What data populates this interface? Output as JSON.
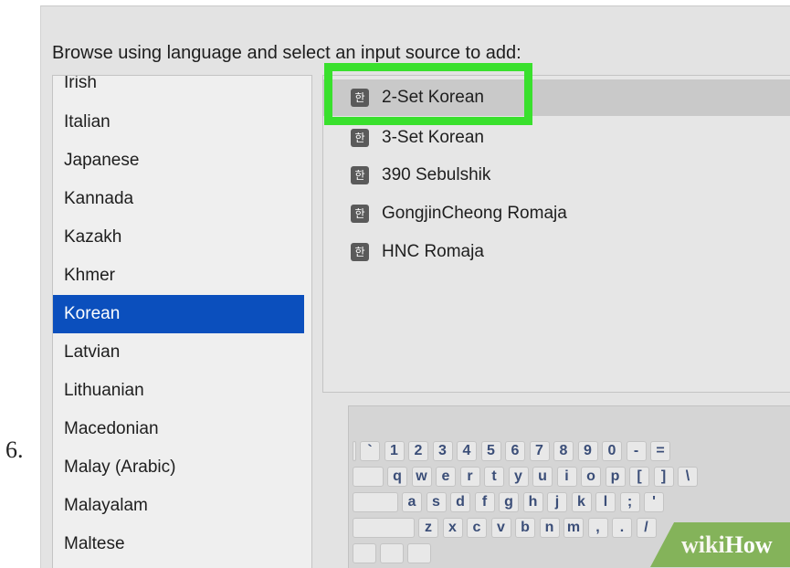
{
  "step_number": "6.",
  "dialog": {
    "prompt": "Browse using language and select an input source to add:"
  },
  "languages": [
    {
      "label": "Irish",
      "selected": false
    },
    {
      "label": "Italian",
      "selected": false
    },
    {
      "label": "Japanese",
      "selected": false
    },
    {
      "label": "Kannada",
      "selected": false
    },
    {
      "label": "Kazakh",
      "selected": false
    },
    {
      "label": "Khmer",
      "selected": false
    },
    {
      "label": "Korean",
      "selected": true
    },
    {
      "label": "Latvian",
      "selected": false
    },
    {
      "label": "Lithuanian",
      "selected": false
    },
    {
      "label": "Macedonian",
      "selected": false
    },
    {
      "label": "Malay (Arabic)",
      "selected": false
    },
    {
      "label": "Malayalam",
      "selected": false
    },
    {
      "label": "Maltese",
      "selected": false
    }
  ],
  "input_sources": [
    {
      "icon": "한",
      "label": "2-Set Korean",
      "selected": true
    },
    {
      "icon": "한",
      "label": "3-Set Korean",
      "selected": false
    },
    {
      "icon": "한",
      "label": "390 Sebulshik",
      "selected": false
    },
    {
      "icon": "한",
      "label": "GongjinCheong Romaja",
      "selected": false
    },
    {
      "icon": "한",
      "label": "HNC Romaja",
      "selected": false
    }
  ],
  "keyboard_rows": [
    [
      "`",
      "1",
      "2",
      "3",
      "4",
      "5",
      "6",
      "7",
      "8",
      "9",
      "0",
      "-",
      "="
    ],
    [
      "q",
      "w",
      "e",
      "r",
      "t",
      "y",
      "u",
      "i",
      "o",
      "p",
      "[",
      "]",
      "\\"
    ],
    [
      "a",
      "s",
      "d",
      "f",
      "g",
      "h",
      "j",
      "k",
      "l",
      ";",
      "'"
    ],
    [
      "z",
      "x",
      "c",
      "v",
      "b",
      "n",
      "m",
      ",",
      ".",
      "/"
    ]
  ],
  "watermark": {
    "wiki": "wiki",
    "how": "How"
  },
  "colors": {
    "selection_blue": "#0b4fbd",
    "highlight_green": "#39e02d",
    "key_text": "#3b4e78",
    "watermark_green": "#84b35a"
  }
}
